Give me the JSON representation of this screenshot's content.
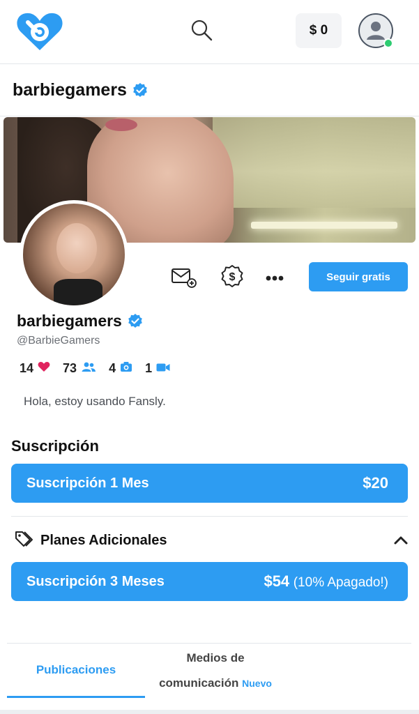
{
  "header": {
    "balance": "$ 0",
    "icons": {
      "logo": "heart-logo-icon",
      "search": "search-icon",
      "account": "user-avatar-icon"
    }
  },
  "profile": {
    "title": "barbiegamers",
    "display_name": "barbiegamers",
    "handle": "@BarbieGamers",
    "bio": "Hola, estoy usando Fansly.",
    "follow_label": "Seguir gratis",
    "stats": {
      "likes": "14",
      "followers": "73",
      "photos": "4",
      "videos": "1"
    },
    "colors": {
      "accent": "#2d9cf2",
      "heart": "#e0245e",
      "online": "#2ecc71"
    }
  },
  "subscription": {
    "title": "Suscripción",
    "main_plan": {
      "label": "Suscripción 1 Mes",
      "price": "$20"
    },
    "additional": {
      "title": "Planes Adicionales",
      "plan": {
        "label": "Suscripción 3 Meses",
        "price": "$54",
        "discount": "(10% Apagado!)"
      }
    }
  },
  "tabs": {
    "publications": "Publicaciones",
    "media_line1": "Medios de",
    "media_line2": "comunicación",
    "media_badge": "Nuevo"
  }
}
